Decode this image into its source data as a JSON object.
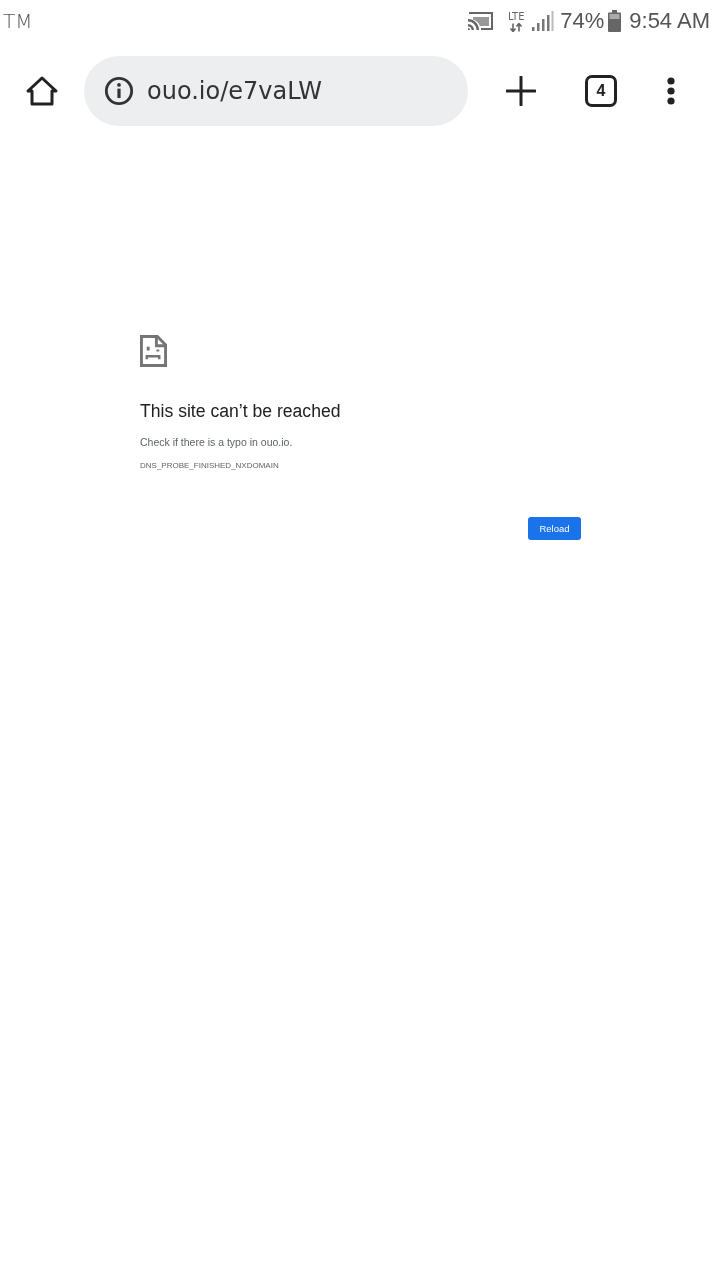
{
  "status_bar": {
    "carrier": "TM",
    "network": "LTE",
    "battery": "74%",
    "time": "9:54 AM"
  },
  "toolbar": {
    "url": "ouo.io/e7vaLW",
    "tab_count": "4"
  },
  "error_page": {
    "title": "This site can’t be reached",
    "message": "Check if there is a typo in ouo.io.",
    "code": "DNS_PROBE_FINISHED_NXDOMAIN",
    "button": "Reload"
  }
}
